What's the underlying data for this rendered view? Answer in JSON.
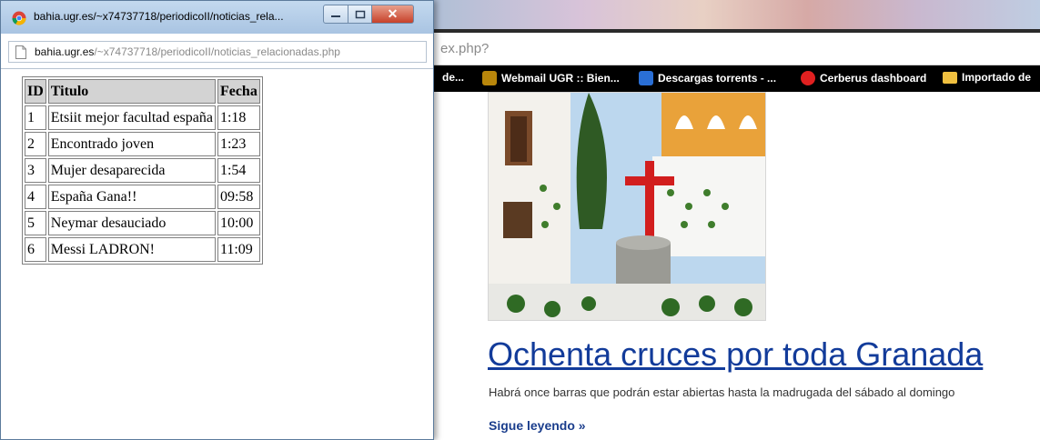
{
  "background_browser": {
    "url_fragment": "ex.php?",
    "bookmarks": [
      {
        "label": "de...",
        "icon": "bookmark-icon",
        "color": "#000000"
      },
      {
        "label": "Webmail UGR :: Bien...",
        "icon": "webmail-icon",
        "color": "#b8860b"
      },
      {
        "label": "Descargas torrents - ...",
        "icon": "torrent-icon",
        "color": "#2a6fd6"
      },
      {
        "label": "Cerberus dashboard",
        "icon": "cerberus-icon",
        "color": "#e02020"
      },
      {
        "label": "Importado de",
        "icon": "folder-icon",
        "color": "#f0c040"
      }
    ],
    "article": {
      "title": "Ochenta cruces por toda Granada",
      "subtitle": "Habrá once barras que podrán estar abiertas hasta la madrugada del sábado al domingo",
      "more_link": "Sigue leyendo »"
    }
  },
  "popup": {
    "title": "bahia.ugr.es/~x74737718/periodicoII/noticias_rela...",
    "url_host": "bahia.ugr.es",
    "url_path": "/~x74737718/periodicoII/noticias_relacionadas.php",
    "controls": {
      "close": "✕"
    },
    "table": {
      "headers": [
        "ID",
        "Titulo",
        "Fecha"
      ],
      "rows": [
        [
          "1",
          "Etsiit mejor facultad españa",
          "1:18"
        ],
        [
          "2",
          "Encontrado joven",
          "1:23"
        ],
        [
          "3",
          "Mujer desaparecida",
          "1:54"
        ],
        [
          "4",
          "España Gana!!",
          "09:58"
        ],
        [
          "5",
          "Neymar desauciado",
          "10:00"
        ],
        [
          "6",
          "Messi LADRON!",
          "11:09"
        ]
      ]
    }
  }
}
